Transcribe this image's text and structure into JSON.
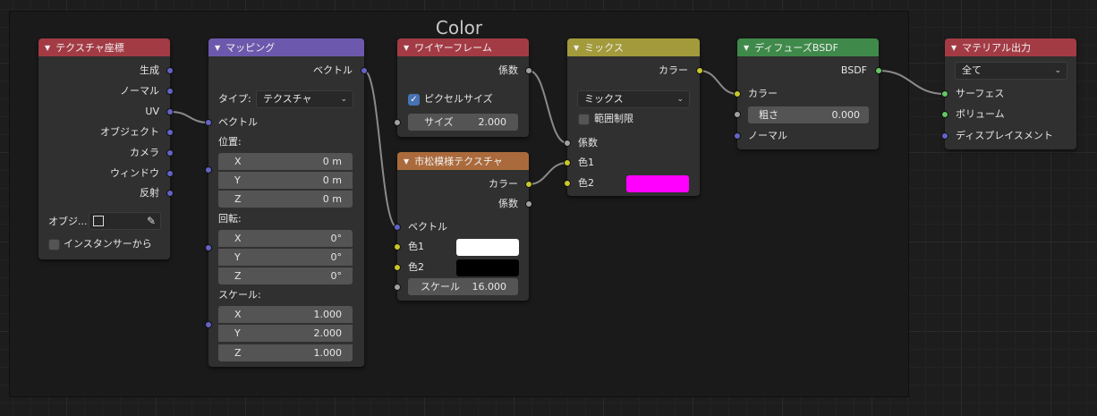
{
  "frame": {
    "title": "Color"
  },
  "colors": {
    "header_input": "#a33b45",
    "header_vector": "#6c59ad",
    "header_texture": "#ab6a3c",
    "header_color": "#a39a3b",
    "header_shader": "#3f8a4a",
    "header_output": "#a33b45",
    "socket_vector": "#6363c7",
    "socket_color": "#c7c729",
    "socket_float": "#a1a1a1",
    "socket_shader": "#63c763",
    "white": "#ffffff",
    "black": "#000000",
    "magenta": "#ff00ff"
  },
  "nodes": {
    "texcoord": {
      "title": "テクスチャ座標",
      "outputs": [
        "生成",
        "ノーマル",
        "UV",
        "オブジェクト",
        "カメラ",
        "ウィンドウ",
        "反射"
      ],
      "object_label": "オブジ...",
      "instancer_label": "インスタンサーから"
    },
    "mapping": {
      "title": "マッピング",
      "output": "ベクトル",
      "type_label": "タイプ:",
      "type_value": "テクスチャ",
      "input_vector": "ベクトル",
      "location_label": "位置:",
      "location": [
        {
          "axis": "X",
          "value": "0 m"
        },
        {
          "axis": "Y",
          "value": "0 m"
        },
        {
          "axis": "Z",
          "value": "0 m"
        }
      ],
      "rotation_label": "回転:",
      "rotation": [
        {
          "axis": "X",
          "value": "0°"
        },
        {
          "axis": "Y",
          "value": "0°"
        },
        {
          "axis": "Z",
          "value": "0°"
        }
      ],
      "scale_label": "スケール:",
      "scale": [
        {
          "axis": "X",
          "value": "1.000"
        },
        {
          "axis": "Y",
          "value": "2.000"
        },
        {
          "axis": "Z",
          "value": "1.000"
        }
      ]
    },
    "wireframe": {
      "title": "ワイヤーフレーム",
      "output": "係数",
      "pixel_size_label": "ピクセルサイズ",
      "size_label": "サイズ",
      "size_value": "2.000"
    },
    "checker": {
      "title": "市松模様テクスチャ",
      "out_color": "カラー",
      "out_factor": "係数",
      "in_vector": "ベクトル",
      "color1_label": "色1",
      "color2_label": "色2",
      "scale_label": "スケール",
      "scale_value": "16.000"
    },
    "mix": {
      "title": "ミックス",
      "output": "カラー",
      "blend_mode": "ミックス",
      "clamp_label": "範囲制限",
      "factor_label": "係数",
      "color1_label": "色1",
      "color2_label": "色2"
    },
    "diffuse": {
      "title": "ディフューズBSDF",
      "output": "BSDF",
      "color_label": "カラー",
      "roughness_label": "粗さ",
      "roughness_value": "0.000",
      "normal_label": "ノーマル"
    },
    "output": {
      "title": "マテリアル出力",
      "target": "全て",
      "surface_label": "サーフェス",
      "volume_label": "ボリューム",
      "displacement_label": "ディスプレイスメント"
    }
  }
}
